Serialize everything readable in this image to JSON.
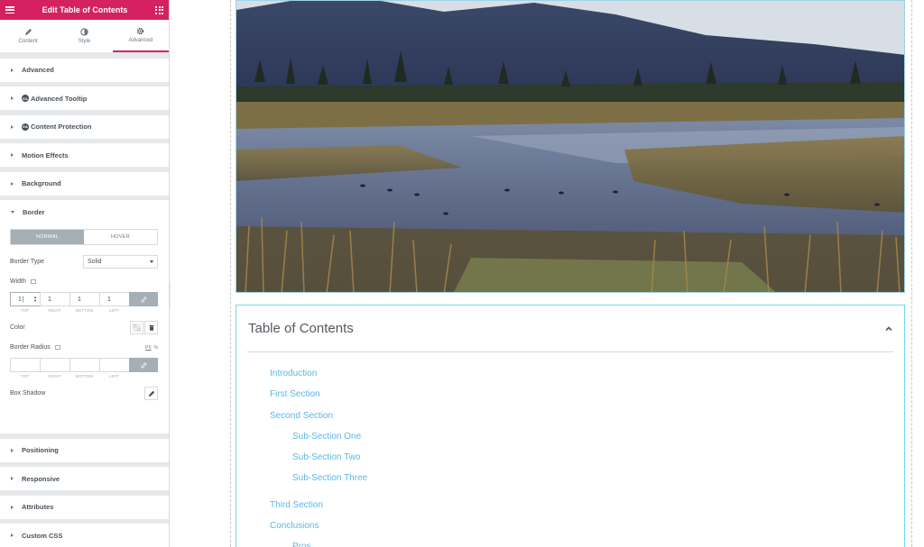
{
  "panel": {
    "title": "Edit Table of Contents",
    "tabs": [
      {
        "label": "Content",
        "icon": "pencil-icon"
      },
      {
        "label": "Style",
        "icon": "half-circle-icon"
      },
      {
        "label": "Advanced",
        "icon": "gear-icon"
      }
    ],
    "sections_top": [
      "Advanced",
      "Advanced Tooltip",
      "Content Protection",
      "Motion Effects",
      "Background"
    ],
    "border_section": "Border",
    "border": {
      "normal": "NORMAL",
      "hover": "HOVER",
      "type_label": "Border Type",
      "type_value": "Solid",
      "width_label": "Width",
      "width_values": {
        "top": "1",
        "right": "1",
        "bottom": "1",
        "left": "1"
      },
      "dim_labels": [
        "TOP",
        "RIGHT",
        "BOTTOM",
        "LEFT"
      ],
      "color_label": "Color",
      "radius_label": "Border Radius",
      "radius_units": "PX",
      "radius_units_alt": "%",
      "shadow_label": "Box Shadow"
    },
    "sections_bottom": [
      "Positioning",
      "Responsive",
      "Attributes",
      "Custom CSS"
    ]
  },
  "toc": {
    "title": "Table of Contents",
    "items": [
      {
        "label": "Introduction",
        "level": 1
      },
      {
        "label": "First Section",
        "level": 1
      },
      {
        "label": "Second Section",
        "level": 1
      },
      {
        "label": "Sub-Section One",
        "level": 2
      },
      {
        "label": "Sub-Section Two",
        "level": 2
      },
      {
        "label": "Sub-Section Three",
        "level": 2
      },
      {
        "label": "Third Section",
        "level": 1
      },
      {
        "label": "Conclusions",
        "level": 1
      },
      {
        "label": "Pros",
        "level": 2
      }
    ]
  },
  "colors": {
    "brand": "#d5215f",
    "link": "#5bb7e5",
    "panel_bg": "#e6e9ec"
  }
}
